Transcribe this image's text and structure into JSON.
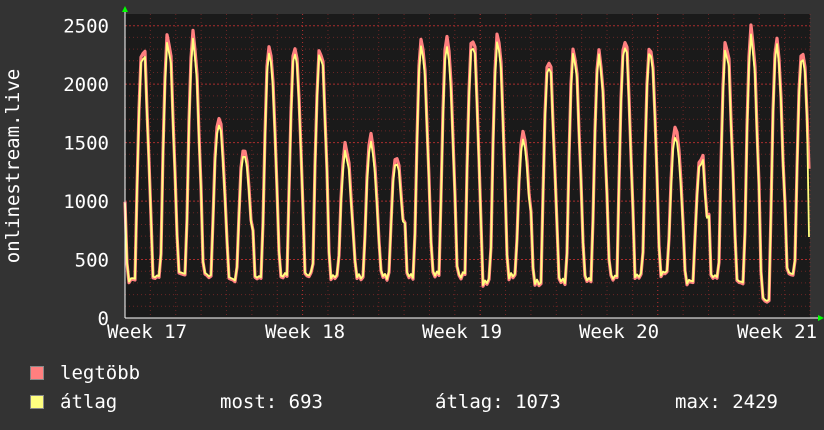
{
  "chart_data": {
    "type": "area",
    "ylabel": "onlinestream.live",
    "ylim": [
      0,
      2600
    ],
    "y_ticks": [
      "0",
      "500",
      "1000",
      "1500",
      "2000",
      "2500"
    ],
    "x_ticks": [
      "Week 17",
      "Week 18",
      "Week 19",
      "Week 20",
      "Week 21"
    ],
    "grid": true,
    "series": [
      {
        "name": "legtöbb",
        "color": "#ff7f7f",
        "daily_peaks": [
          2300,
          2420,
          2430,
          1700,
          1460,
          2350,
          2340,
          2310,
          1480,
          1560,
          1380,
          2400,
          2430,
          2410,
          2440,
          1590,
          2200,
          2300,
          2290,
          2380,
          2340,
          1650,
          1370,
          2360,
          2480,
          2390,
          2300
        ],
        "daily_troughs": [
          320,
          340,
          370,
          360,
          330,
          350,
          360,
          360,
          340,
          340,
          350,
          360,
          380,
          360,
          300,
          350,
          290,
          310,
          330,
          350,
          360,
          380,
          300,
          340,
          300,
          150,
          380
        ]
      },
      {
        "name": "átlag",
        "color": "#ffff80",
        "daily_peaks": [
          2250,
          2350,
          2360,
          1640,
          1410,
          2290,
          2290,
          2270,
          1410,
          1490,
          1330,
          2340,
          2340,
          2350,
          2370,
          1520,
          2150,
          2260,
          2250,
          2330,
          2300,
          1560,
          1330,
          2290,
          2400,
          2340,
          2250
        ],
        "daily_troughs": [
          330,
          350,
          380,
          370,
          340,
          360,
          370,
          370,
          350,
          350,
          360,
          370,
          390,
          370,
          310,
          360,
          300,
          320,
          340,
          360,
          370,
          390,
          310,
          350,
          310,
          160,
          390
        ],
        "last_value": 693
      }
    ],
    "legend": {
      "max_label": "legtöbb",
      "avg_label": "átlag",
      "stats": [
        {
          "key": "most",
          "value": "693"
        },
        {
          "key": "átlag",
          "value": "1073"
        },
        {
          "key": "max",
          "value": "2429"
        }
      ]
    }
  },
  "colors": {
    "background": "#333333",
    "plot_background": "#1a1a1a",
    "grid": "#cc3333",
    "axis_arrow": "#00ff00",
    "max_series": "#ff7f7f",
    "avg_series": "#ffff80"
  }
}
